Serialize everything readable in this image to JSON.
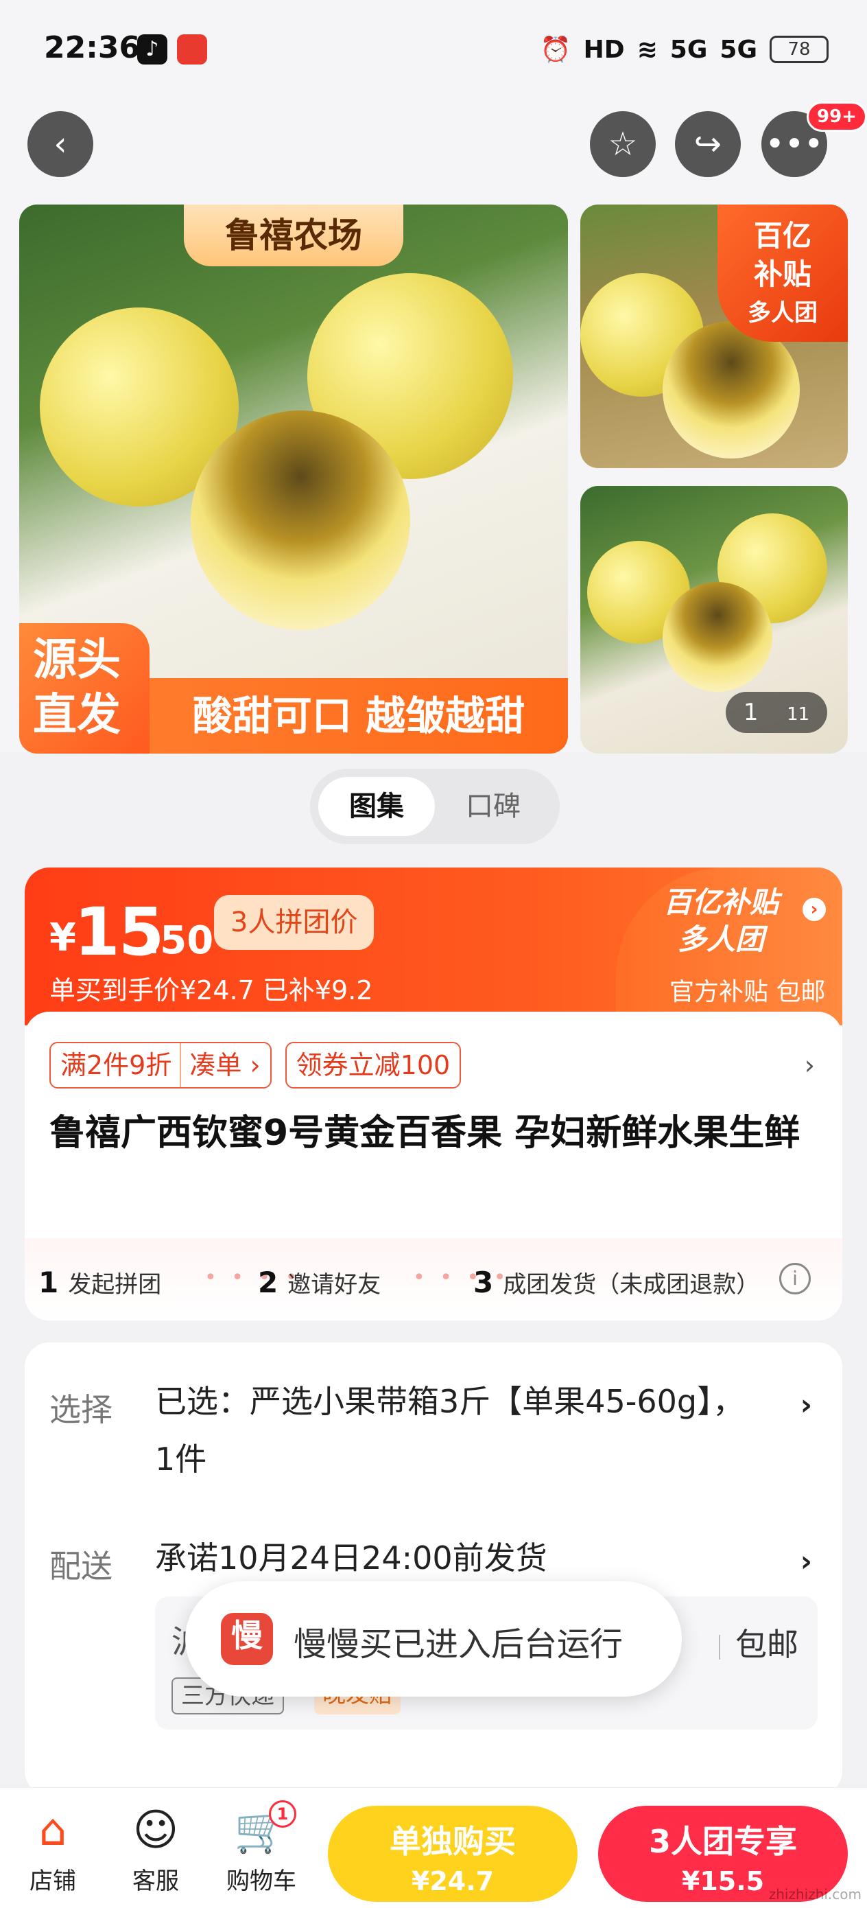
{
  "status_bar": {
    "time": "22:36",
    "hd": "HD",
    "net1": "5G",
    "net2": "5G",
    "battery": "78"
  },
  "nav": {
    "back_icon": "chevron-left-icon",
    "fav_icon": "star-icon",
    "share_icon": "share-icon",
    "more_icon": "more-icon",
    "more_badge": "99+"
  },
  "gallery": {
    "main": {
      "farm_label": "鲁禧农场",
      "source_tag_1": "源头",
      "source_tag_2": "直发",
      "slogan": "酸甜可口 越皱越甜"
    },
    "side_tag": {
      "line1": "百亿",
      "line2": "补贴",
      "line3": "多人团"
    },
    "counter": {
      "current": "1",
      "total": "11"
    }
  },
  "toggle": {
    "active": "图集",
    "inactive": "口碑"
  },
  "price": {
    "symbol": "¥",
    "integer": "15",
    "decimal": ".50",
    "group_tag": "3人拼团价",
    "single_price_text": "单买到手价¥24.7  已补¥9.2",
    "bys_line1": "百亿补贴",
    "bys_line2": "多人团",
    "bys_sub": "官方补贴 包邮"
  },
  "promos": {
    "tag1_a": "满2件9折",
    "tag1_b": "凑单 ›",
    "tag2": "领券立减100",
    "more": "›"
  },
  "product": {
    "title": "鲁禧广西钦蜜9号黄金百香果 孕妇新鲜水果生鲜"
  },
  "steps": {
    "s1_num": "1",
    "s1": "发起拼团",
    "s2_num": "2",
    "s2": "邀请好友",
    "s3_num": "3",
    "s3": "成团发货（未成团退款）",
    "info": "i"
  },
  "options": {
    "select_label": "选择",
    "select_value": "已选：严选小果带箱3斤【单果45-60g】，1件",
    "delivery_label": "配送",
    "delivery_value": "承诺10月24日24:00前发货",
    "delivery_lead": "沪",
    "delivery_free": "包邮",
    "tag_express": "三方快递",
    "tag_late": "晚发赔"
  },
  "toast": {
    "icon_text": "慢",
    "text": "慢慢买已进入后台运行"
  },
  "bottom": {
    "shop": "店铺",
    "cs": "客服",
    "cart": "购物车",
    "cart_count": "1",
    "single_label": "单独购买",
    "single_price": "¥24.7",
    "group_label": "3人团专享",
    "group_price": "¥15.5"
  },
  "watermark": "zhizhizhi.com",
  "colors": {
    "accent": "#ff4a1d",
    "buy_single": "#ffd21e",
    "buy_group": "#ff2d47"
  }
}
